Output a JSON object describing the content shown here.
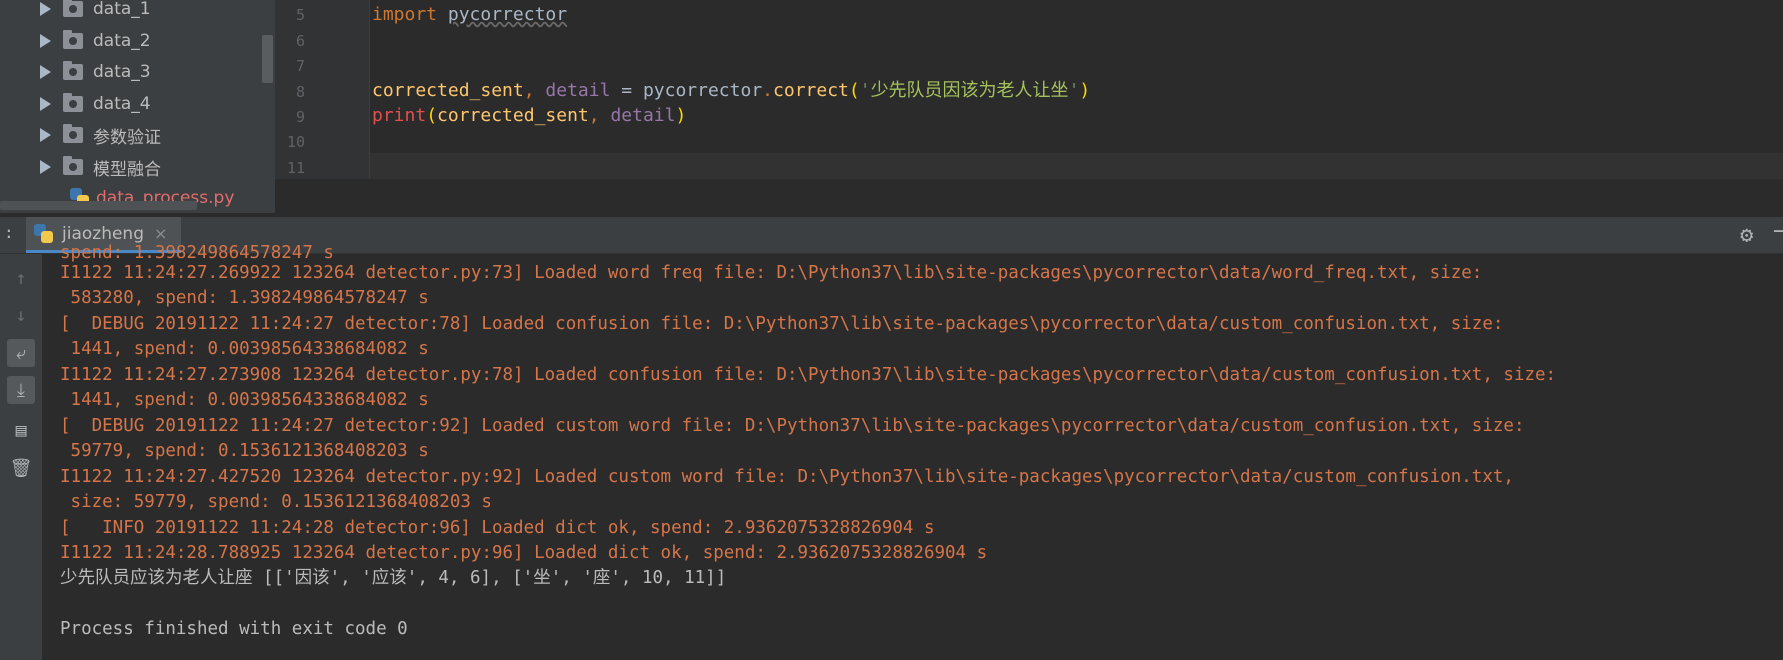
{
  "project_tree": {
    "items": [
      {
        "label": "data_1",
        "type": "folder"
      },
      {
        "label": "data_2",
        "type": "folder"
      },
      {
        "label": "data_3",
        "type": "folder"
      },
      {
        "label": "data_4",
        "type": "folder"
      },
      {
        "label": "参数验证",
        "type": "folder"
      },
      {
        "label": "模型融合",
        "type": "folder"
      },
      {
        "label": "data_process.py",
        "type": "python-file"
      }
    ]
  },
  "editor": {
    "line_numbers": [
      "5",
      "6",
      "7",
      "8",
      "9",
      "10",
      "11"
    ],
    "line5": {
      "kw": "import",
      "module": "pycorrector"
    },
    "line8": {
      "v1": "corrected_sent",
      "comma": ", ",
      "v2": "detail",
      "eq": " = ",
      "obj": "pycorrector",
      "dot": ".",
      "fn": "correct",
      "lp": "(",
      "q1": "'",
      "str": "少先队员因该为老人让坐",
      "q2": "'",
      "rp": ")"
    },
    "line9": {
      "fn": "print",
      "lp": "(",
      "a1": "corrected_sent",
      "comma": ", ",
      "a2": "detail",
      "rp": ")"
    }
  },
  "run_panel": {
    "tab_label": "jiaozheng",
    "close_glyph": "×",
    "colon": ":",
    "settings_icon": "gear-icon",
    "minimize_icon": "minus-icon"
  },
  "toolbar": {
    "icons": [
      "arrow-up-icon",
      "arrow-down-icon",
      "soft-wrap-icon",
      "scroll-to-end-icon",
      "print-icon",
      "trash-icon"
    ]
  },
  "console": {
    "cut_line": "spend: 1.398249864578247 s",
    "lines": [
      {
        "text": "I1122 11:24:27.269922 123264 detector.py:73] Loaded word freq file: D:\\Python37\\lib\\site-packages\\pycorrector\\data/word_freq.txt, size:",
        "kind": "log"
      },
      {
        "text": " 583280, spend: 1.398249864578247 s",
        "kind": "log"
      },
      {
        "text": "[  DEBUG 20191122 11:24:27 detector:78] Loaded confusion file: D:\\Python37\\lib\\site-packages\\pycorrector\\data/custom_confusion.txt, size:",
        "kind": "log"
      },
      {
        "text": " 1441, spend: 0.00398564338684082 s",
        "kind": "log"
      },
      {
        "text": "I1122 11:24:27.273908 123264 detector.py:78] Loaded confusion file: D:\\Python37\\lib\\site-packages\\pycorrector\\data/custom_confusion.txt, size:",
        "kind": "log"
      },
      {
        "text": " 1441, spend: 0.00398564338684082 s",
        "kind": "log"
      },
      {
        "text": "[  DEBUG 20191122 11:24:27 detector:92] Loaded custom word file: D:\\Python37\\lib\\site-packages\\pycorrector\\data/custom_confusion.txt, size:",
        "kind": "log"
      },
      {
        "text": " 59779, spend: 0.1536121368408203 s",
        "kind": "log"
      },
      {
        "text": "I1122 11:24:27.427520 123264 detector.py:92] Loaded custom word file: D:\\Python37\\lib\\site-packages\\pycorrector\\data/custom_confusion.txt,",
        "kind": "log"
      },
      {
        "text": " size: 59779, spend: 0.1536121368408203 s",
        "kind": "log"
      },
      {
        "text": "[   INFO 20191122 11:24:28 detector:96] Loaded dict ok, spend: 2.9362075328826904 s",
        "kind": "log"
      },
      {
        "text": "I1122 11:24:28.788925 123264 detector.py:96] Loaded dict ok, spend: 2.9362075328826904 s",
        "kind": "log"
      },
      {
        "text": "少先队员应该为老人让座 [['因该', '应该', 4, 6], ['坐', '座', 10, 11]]",
        "kind": "normal"
      },
      {
        "text": "",
        "kind": "normal"
      },
      {
        "text": "Process finished with exit code 0",
        "kind": "normal"
      }
    ]
  }
}
